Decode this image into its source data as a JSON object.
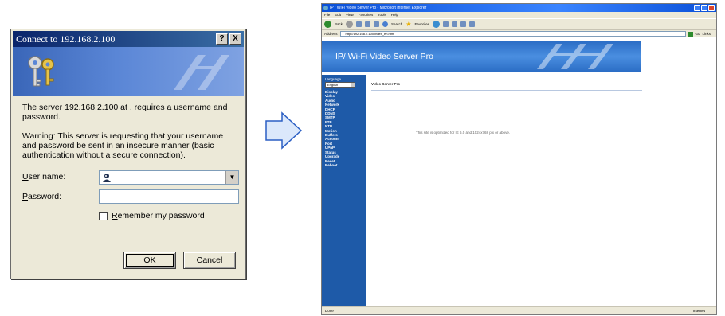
{
  "dialog": {
    "title": "Connect to 192.168.2.100",
    "title_help": "?",
    "title_close": "X",
    "prompt": "The server 192.168.2.100 at . requires a username and password.",
    "warning": "Warning: This server is requesting that your username and password be sent in an insecure manner (basic authentication without a secure connection).",
    "user_label_first": "U",
    "user_label_rest": "ser name:",
    "password_label_first": "P",
    "password_label_rest": "assword:",
    "user_value": "",
    "password_value": "",
    "remember_first": "R",
    "remember_rest": "emember my password",
    "remember_checked": false,
    "ok_label": "OK",
    "cancel_label": "Cancel"
  },
  "browser": {
    "title": "IP / WiFi Video Server Pro - Microsoft Internet Explorer",
    "menu": [
      "File",
      "Edit",
      "View",
      "Favorites",
      "Tools",
      "Help"
    ],
    "toolbar": {
      "back": "Back",
      "search": "Search",
      "favorites": "Favorites"
    },
    "address_label": "Address",
    "address": "http://192.168.2.100/index_en.html",
    "go_label": "Go",
    "links_label": "Links",
    "banner_title": "IP/ Wi-Fi Video Server Pro",
    "language_label": "Language",
    "language_value": "English",
    "nav_items": [
      "Display",
      "Video",
      "Audio",
      "Network",
      "DHCP",
      "DDNS",
      "SMTP",
      "FTP",
      "NTP",
      "Motion",
      "Buffers",
      "Account",
      "Port",
      "UPnP",
      "Status",
      "Upgrade",
      "Reset",
      "Reboot"
    ],
    "content_title": "Video Server Pro",
    "content_note": "This site is optimized for IE 6.0 and 1024x768 pix or above.",
    "status_left": "Done",
    "status_zone": "Internet"
  },
  "colors": {
    "xp_title_blue": "#0a246a",
    "banner_blue": "#2a6cc4",
    "nav_blue": "#1e5aa8",
    "arrow_fill": "#dbe8fb",
    "arrow_stroke": "#2b5fc4"
  }
}
